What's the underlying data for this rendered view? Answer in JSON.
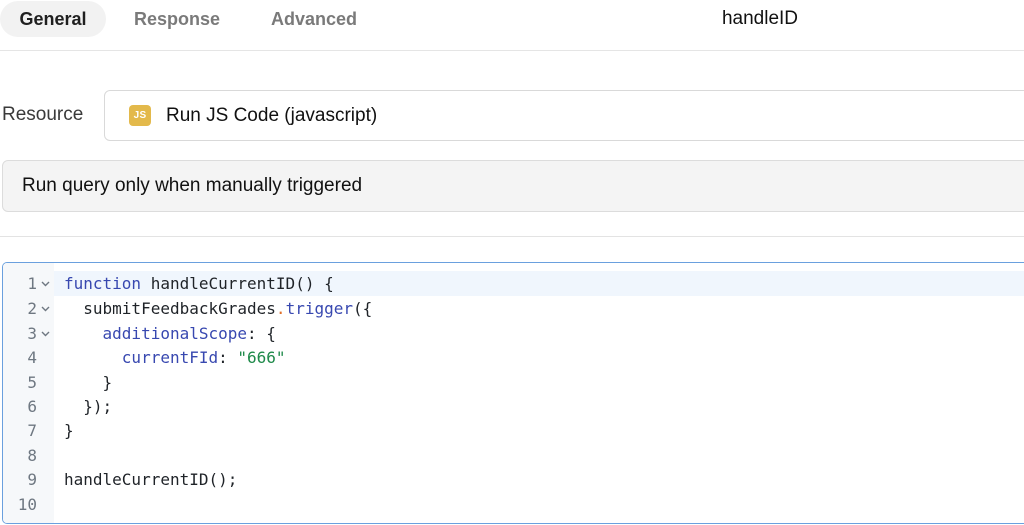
{
  "tabs": {
    "general": "General",
    "response": "Response",
    "advanced": "Advanced"
  },
  "query_name": "handleID",
  "resource": {
    "label": "Resource",
    "badge": "JS",
    "value": "Run JS Code (javascript)"
  },
  "trigger": {
    "value": "Run query only when manually triggered"
  },
  "editor": {
    "line_numbers": [
      "1",
      "2",
      "3",
      "4",
      "5",
      "6",
      "7",
      "8",
      "9",
      "10"
    ],
    "lines": [
      {
        "indent": "",
        "kw": "function",
        "rest": " handleCurrentID() {"
      },
      {
        "indent": "  ",
        "obj": "submitFeedbackGrades",
        "dot": ".",
        "method": "trigger",
        "rest": "({"
      },
      {
        "indent": "    ",
        "prop": "additionalScope",
        "rest": ": {"
      },
      {
        "indent": "      ",
        "prop": "currentFId",
        "sep": ": ",
        "str": "\"666\""
      },
      {
        "text": "    }"
      },
      {
        "text": "  });"
      },
      {
        "text": "}"
      },
      {
        "text": ""
      },
      {
        "text": "handleCurrentID();"
      },
      {
        "text": ""
      }
    ]
  },
  "icons": {
    "fold": "chevron-down-icon"
  },
  "colors": {
    "keyword": "#3848b0",
    "string": "#1f8a4a",
    "dot": "#e0702a",
    "js_badge": "#e3b94b",
    "editor_border": "#6aa0de"
  }
}
